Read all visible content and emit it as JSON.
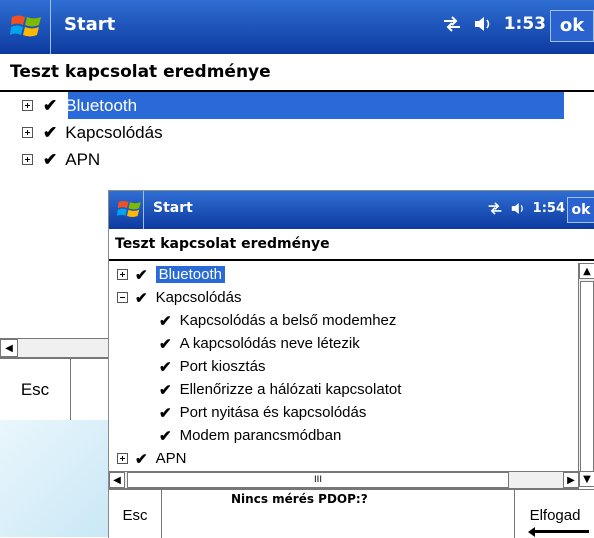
{
  "screen1": {
    "title": "Start",
    "time": "1:53",
    "ok_label": "ok",
    "heading": "Teszt kapcsolat eredménye",
    "tree": [
      {
        "label": "Bluetooth",
        "check": "✔"
      },
      {
        "label": "Kapcsolódás",
        "check": "✔"
      },
      {
        "label": "APN",
        "check": "✔"
      }
    ],
    "esc_label": "Esc"
  },
  "screen2": {
    "title": "Start",
    "time": "1:54",
    "ok_label": "ok",
    "heading": "Teszt kapcsolat eredménye",
    "tree": [
      {
        "label": "Bluetooth",
        "check": "✔"
      },
      {
        "label": "Kapcsolódás",
        "check": "✔"
      },
      {
        "label": "Kapcsolódás a belső modemhez",
        "check": "✔"
      },
      {
        "label": "A kapcsolódás neve létezik",
        "check": "✔"
      },
      {
        "label": "Port kiosztás",
        "check": "✔"
      },
      {
        "label": "Ellenőrizze a hálózati kapcsolatot",
        "check": "✔"
      },
      {
        "label": "Port nyitása és kapcsolódás",
        "check": "✔"
      },
      {
        "label": "Modem parancsmódban",
        "check": "✔"
      },
      {
        "label": "APN",
        "check": "✔"
      }
    ],
    "esc_label": "Esc",
    "gps_status": "Nincs mérés  PDOP:?",
    "accept_label": "Elfogad"
  },
  "colors": {
    "titlebar": "#1f55c6",
    "selection": "#2a6ad8"
  },
  "icons": [
    "windows-start-icon",
    "connectivity-icon",
    "speaker-icon",
    "expand-plus-icon",
    "collapse-minus-icon",
    "check-icon"
  ]
}
